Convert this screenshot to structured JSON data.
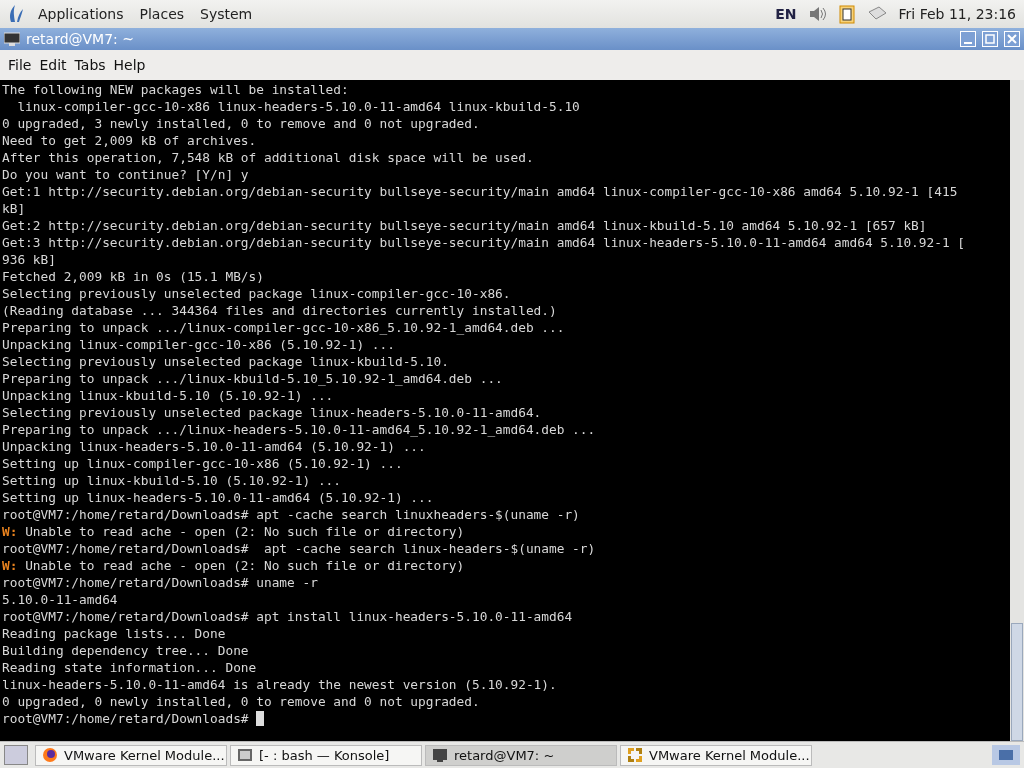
{
  "top_panel": {
    "menus": [
      "Applications",
      "Places",
      "System"
    ],
    "keyboard_layout": "EN",
    "clock": "Fri Feb 11, 23:16"
  },
  "window": {
    "title": "retard@VM7: ~",
    "menu": [
      "File",
      "Edit",
      "Tabs",
      "Help"
    ]
  },
  "terminal": {
    "lines": [
      {
        "text": "The following NEW packages will be installed:"
      },
      {
        "text": "  linux-compiler-gcc-10-x86 linux-headers-5.10.0-11-amd64 linux-kbuild-5.10"
      },
      {
        "text": "0 upgraded, 3 newly installed, 0 to remove and 0 not upgraded."
      },
      {
        "text": "Need to get 2,009 kB of archives."
      },
      {
        "text": "After this operation, 7,548 kB of additional disk space will be used."
      },
      {
        "text": "Do you want to continue? [Y/n] y"
      },
      {
        "text": "Get:1 http://security.debian.org/debian-security bullseye-security/main amd64 linux-compiler-gcc-10-x86 amd64 5.10.92-1 [415"
      },
      {
        "text": "kB]"
      },
      {
        "text": "Get:2 http://security.debian.org/debian-security bullseye-security/main amd64 linux-kbuild-5.10 amd64 5.10.92-1 [657 kB]"
      },
      {
        "text": "Get:3 http://security.debian.org/debian-security bullseye-security/main amd64 linux-headers-5.10.0-11-amd64 amd64 5.10.92-1 ["
      },
      {
        "text": "936 kB]"
      },
      {
        "text": "Fetched 2,009 kB in 0s (15.1 MB/s)"
      },
      {
        "text": "Selecting previously unselected package linux-compiler-gcc-10-x86."
      },
      {
        "text": "(Reading database ... 344364 files and directories currently installed.)"
      },
      {
        "text": "Preparing to unpack .../linux-compiler-gcc-10-x86_5.10.92-1_amd64.deb ..."
      },
      {
        "text": "Unpacking linux-compiler-gcc-10-x86 (5.10.92-1) ..."
      },
      {
        "text": "Selecting previously unselected package linux-kbuild-5.10."
      },
      {
        "text": "Preparing to unpack .../linux-kbuild-5.10_5.10.92-1_amd64.deb ..."
      },
      {
        "text": "Unpacking linux-kbuild-5.10 (5.10.92-1) ..."
      },
      {
        "text": "Selecting previously unselected package linux-headers-5.10.0-11-amd64."
      },
      {
        "text": "Preparing to unpack .../linux-headers-5.10.0-11-amd64_5.10.92-1_amd64.deb ..."
      },
      {
        "text": "Unpacking linux-headers-5.10.0-11-amd64 (5.10.92-1) ..."
      },
      {
        "text": "Setting up linux-compiler-gcc-10-x86 (5.10.92-1) ..."
      },
      {
        "text": "Setting up linux-kbuild-5.10 (5.10.92-1) ..."
      },
      {
        "text": "Setting up linux-headers-5.10.0-11-amd64 (5.10.92-1) ..."
      },
      {
        "text": "root@VM7:/home/retard/Downloads# apt -cache search linuxheaders-$(uname -r)"
      },
      {
        "tag": "W:",
        "text": " Unable to read ache - open (2: No such file or directory)"
      },
      {
        "text": "root@VM7:/home/retard/Downloads#  apt -cache search linux-headers-$(uname -r)"
      },
      {
        "tag": "W:",
        "text": " Unable to read ache - open (2: No such file or directory)"
      },
      {
        "text": "root@VM7:/home/retard/Downloads# uname -r"
      },
      {
        "text": "5.10.0-11-amd64"
      },
      {
        "text": "root@VM7:/home/retard/Downloads# apt install linux-headers-5.10.0-11-amd64"
      },
      {
        "text": "Reading package lists... Done"
      },
      {
        "text": "Building dependency tree... Done"
      },
      {
        "text": "Reading state information... Done"
      },
      {
        "text": "linux-headers-5.10.0-11-amd64 is already the newest version (5.10.92-1)."
      },
      {
        "text": "0 upgraded, 0 newly installed, 0 to remove and 0 not upgraded."
      },
      {
        "text": "root@VM7:/home/retard/Downloads# ",
        "cursor": true
      }
    ]
  },
  "taskbar": {
    "items": [
      {
        "kind": "browser",
        "label": "VMware Kernel Module...",
        "selected": false
      },
      {
        "kind": "console",
        "label": "[- : bash — Konsole]",
        "selected": false
      },
      {
        "kind": "terminal",
        "label": "retard@VM7: ~",
        "selected": true
      },
      {
        "kind": "installer",
        "label": "VMware Kernel Module...",
        "selected": false
      }
    ]
  }
}
